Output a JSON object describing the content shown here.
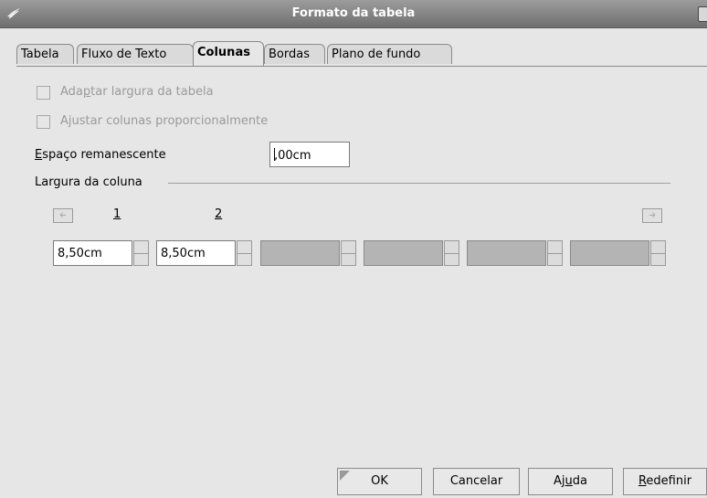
{
  "window": {
    "title": "Formato da tabela",
    "app_icon": "writer-seagull-icon",
    "close_icon": "close-icon"
  },
  "tabs": [
    {
      "label": "Tabela",
      "active": false
    },
    {
      "label": "Fluxo de Texto",
      "active": false
    },
    {
      "label": "Colunas",
      "active": true
    },
    {
      "label": "Bordas",
      "active": false
    },
    {
      "label": "Plano de fundo",
      "active": false
    }
  ],
  "options": {
    "adapt_width": {
      "label_pre": "Ada",
      "label_mn": "p",
      "label_post": "tar largura da tabela",
      "checked": false,
      "enabled": false
    },
    "adjust_columns": {
      "label_pre": "A",
      "label_mn": "j",
      "label_post": "ustar colunas proporcionalmente",
      "checked": false,
      "enabled": false
    }
  },
  "remaining_space": {
    "label_mn": "E",
    "label_post": "spaço remanescente",
    "value": "0,00cm",
    "value_after_caret": ",00cm"
  },
  "column_width": {
    "group_label": "Largura da coluna",
    "left_arrow_icon": "arrow-left-icon",
    "right_arrow_icon": "arrow-right-icon",
    "column_numbers": [
      "1",
      "2"
    ],
    "fields": [
      {
        "value": "8,50cm",
        "enabled": true
      },
      {
        "value": "8,50cm",
        "enabled": true
      },
      {
        "value": "",
        "enabled": false
      },
      {
        "value": "",
        "enabled": false
      },
      {
        "value": "",
        "enabled": false
      },
      {
        "value": "",
        "enabled": false
      }
    ]
  },
  "buttons": {
    "ok": "OK",
    "cancel": "Cancelar",
    "help_pre": "Aj",
    "help_mn": "u",
    "help_post": "da",
    "reset_mn": "R",
    "reset_post": "edefinir"
  },
  "colors": {
    "dialog_bg": "#e6e6e6",
    "titlebar": "#7f7f7f",
    "disabled_field": "#b4b4b4"
  }
}
